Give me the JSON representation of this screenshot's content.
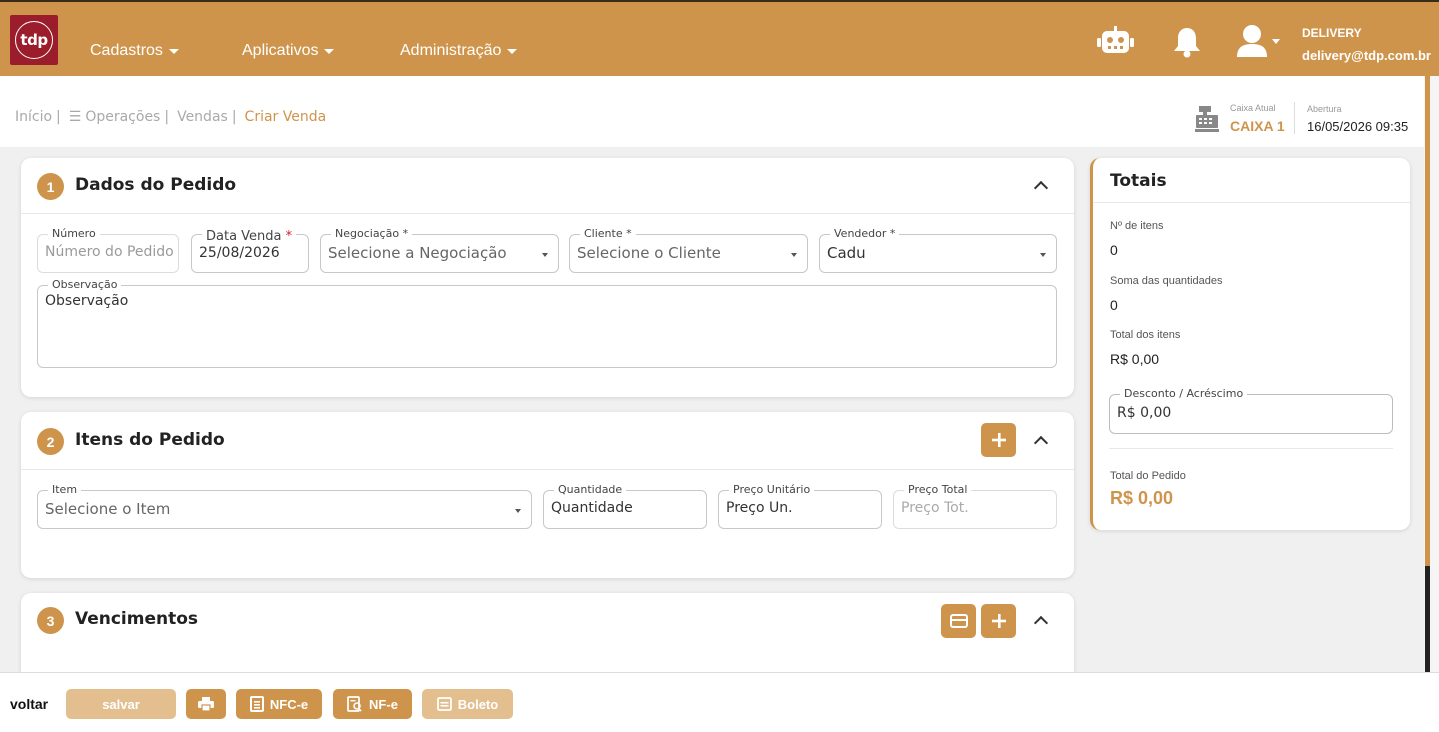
{
  "header": {
    "logo_text": "tdp",
    "nav": [
      {
        "label": "Cadastros"
      },
      {
        "label": "Aplicativos"
      },
      {
        "label": "Administração"
      }
    ],
    "user_name": "DELIVERY",
    "user_email": "delivery@tdp.com.br"
  },
  "breadcrumb": {
    "inicio": "Início",
    "operacoes": "Operações",
    "vendas": "Vendas",
    "current": "Criar Venda",
    "separator": "|"
  },
  "caixa": {
    "label": "Caixa Atual",
    "value": "CAIXA 1",
    "abertura_label": "Abertura",
    "abertura_value": "16/05/2026 09:35"
  },
  "dados_pedido": {
    "step": "1",
    "title": "Dados do Pedido",
    "numero": {
      "label": "Número",
      "placeholder": "Número do Pedido"
    },
    "data_venda": {
      "label": "Data Venda",
      "required": "*",
      "value": "25/08/2026"
    },
    "negociacao": {
      "label": "Negociação *",
      "placeholder": "Selecione a Negociação"
    },
    "cliente": {
      "label": "Cliente *",
      "placeholder": "Selecione o Cliente"
    },
    "vendedor": {
      "label": "Vendedor *",
      "value": "Cadu"
    },
    "observacao": {
      "label": "Observação",
      "value": "Observação"
    }
  },
  "itens_pedido": {
    "step": "2",
    "title": "Itens do Pedido",
    "item": {
      "label": "Item",
      "placeholder": "Selecione o Item"
    },
    "quantidade": {
      "label": "Quantidade",
      "value": "Quantidade"
    },
    "preco_unitario": {
      "label": "Preço Unitário",
      "value": "Preço Un."
    },
    "preco_total": {
      "label": "Preço Total",
      "placeholder": "Preço Tot."
    }
  },
  "vencimentos": {
    "step": "3",
    "title": "Vencimentos"
  },
  "totais": {
    "title": "Totais",
    "n_itens_label": "Nº de itens",
    "n_itens_value": "0",
    "soma_label": "Soma das quantidades",
    "soma_value": "0",
    "total_itens_label": "Total dos itens",
    "total_itens_value": "R$ 0,00",
    "desconto_label": "Desconto / Acréscimo",
    "desconto_value": "R$ 0,00",
    "total_pedido_label": "Total do Pedido",
    "total_pedido_value": "R$ 0,00"
  },
  "footer": {
    "voltar": "voltar",
    "salvar": "salvar",
    "nfce": "NFC-e",
    "nfe": "NF-e",
    "boleto": "Boleto"
  },
  "colors": {
    "accent": "#cf944c",
    "accent_faded": "#e3bf8f",
    "logo_bg": "#9b1c2a"
  }
}
